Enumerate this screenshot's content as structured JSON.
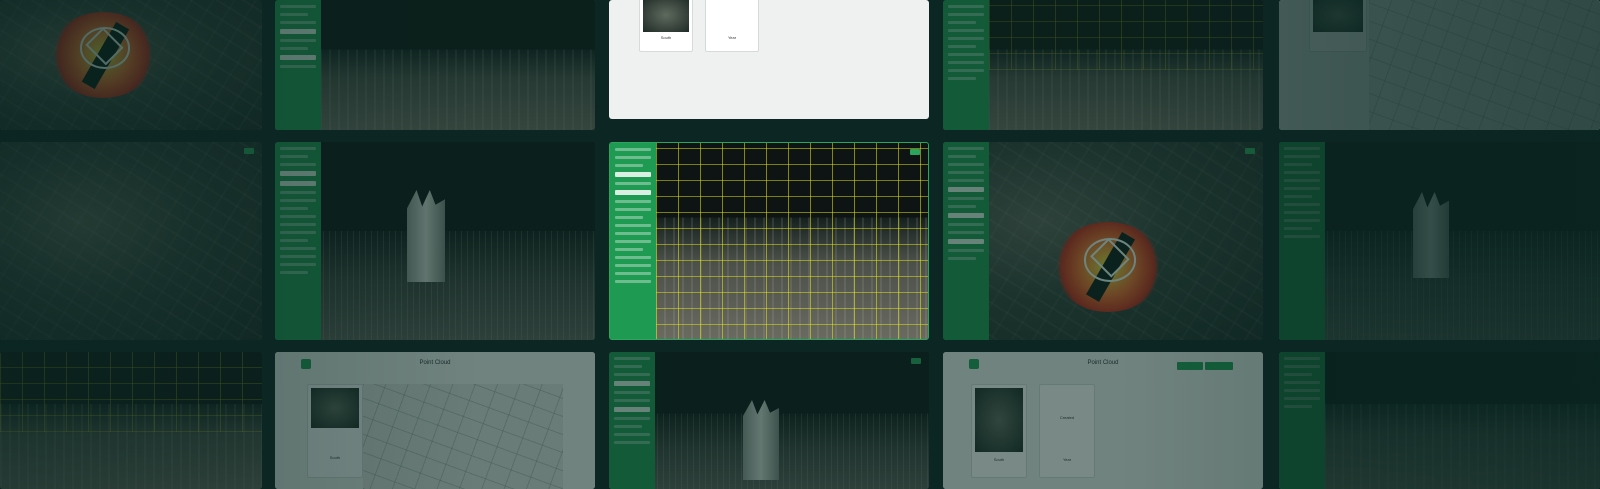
{
  "panels": {
    "point_cloud_top": {
      "card_left_label": "South",
      "card_right_label": "Year"
    },
    "point_cloud_bottom_left": {
      "title": "Point Cloud",
      "card_label": "South"
    },
    "point_cloud_bottom_right": {
      "title": "Point Cloud",
      "card_left_label": "South",
      "card_right_label": "Year",
      "card_right_center": "Created"
    }
  },
  "colors": {
    "accent_green": "#1f9a52",
    "background": "#0c2723",
    "grid_yellow": "#e6e614"
  }
}
